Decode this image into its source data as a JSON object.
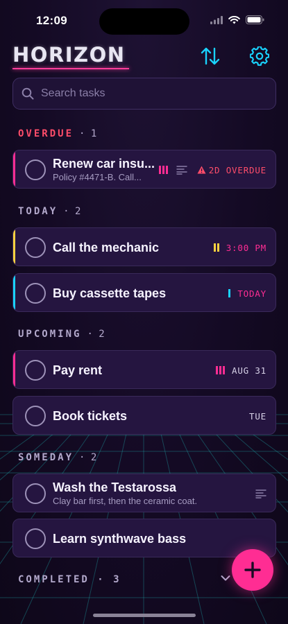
{
  "status_bar": {
    "time": "12:09"
  },
  "app": {
    "title": "HORIZON"
  },
  "search": {
    "placeholder": "Search tasks"
  },
  "colors": {
    "accent": "#ff2d93",
    "cyan": "#19d3ff",
    "yellow": "#ffd23f",
    "red": "#ff4d6a"
  },
  "sections": {
    "overdue": {
      "label": "OVERDUE",
      "count": "· 1"
    },
    "today": {
      "label": "TODAY",
      "count": "· 2"
    },
    "upcoming": {
      "label": "UPCOMING",
      "count": "· 2"
    },
    "someday": {
      "label": "SOMEDAY",
      "count": "· 2"
    },
    "completed": {
      "label": "COMPLETED · 3"
    }
  },
  "tasks": {
    "renew": {
      "title": "Renew car insu...",
      "subtitle": "Policy #4471-B. Call...",
      "due": "2D OVERDUE",
      "priority": "high"
    },
    "mechanic": {
      "title": "Call the mechanic",
      "due": "3:00 PM",
      "priority": "medium"
    },
    "cassette": {
      "title": "Buy cassette tapes",
      "due": "TODAY",
      "priority": "low"
    },
    "rent": {
      "title": "Pay rent",
      "due": "AUG 31",
      "priority": "high"
    },
    "tickets": {
      "title": "Book tickets",
      "due": "TUE"
    },
    "wash": {
      "title": "Wash the Testarossa",
      "subtitle": "Clay bar first, then the ceramic coat."
    },
    "synth": {
      "title": "Learn synthwave bass"
    }
  }
}
